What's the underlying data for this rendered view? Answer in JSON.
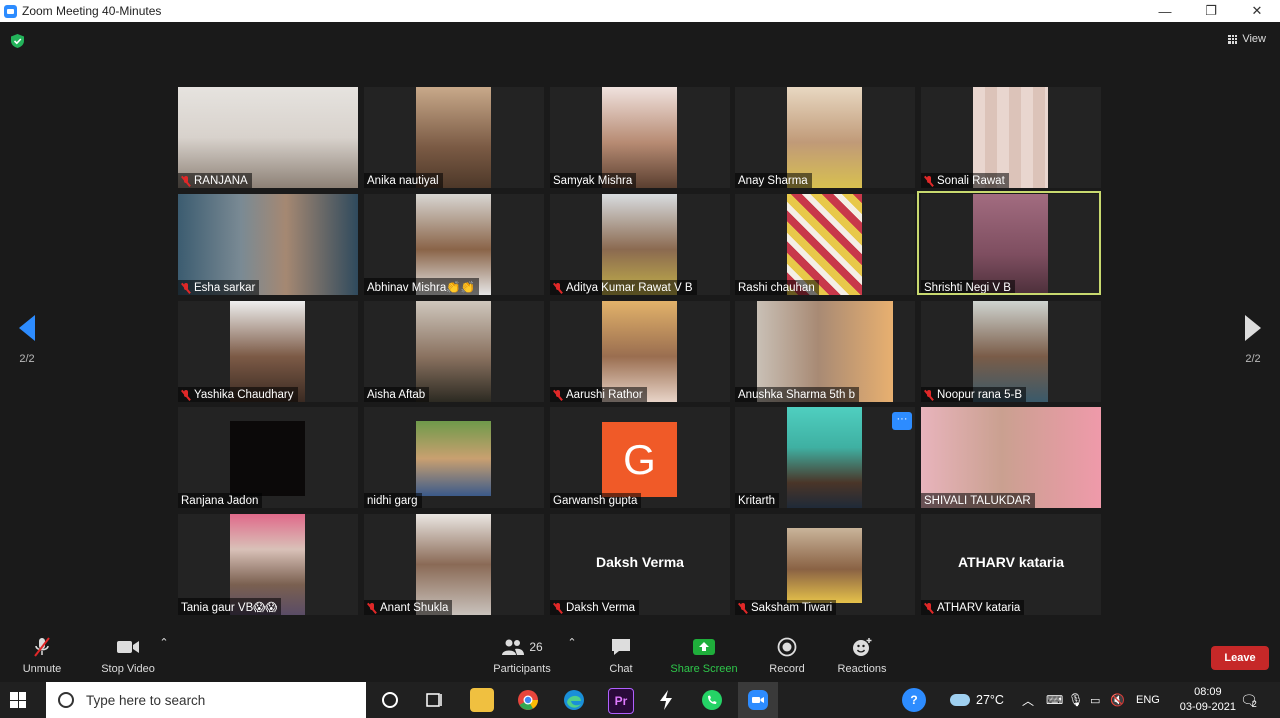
{
  "window": {
    "title": "Zoom Meeting 40-Minutes",
    "minimize": "—",
    "restore": "❐",
    "close": "✕"
  },
  "header": {
    "view_label": "View"
  },
  "pagination": {
    "left": "2/2",
    "right": "2/2"
  },
  "participants_tiles": [
    {
      "name": "RANJANA",
      "muted": true,
      "video": true
    },
    {
      "name": "Anika nautiyal",
      "muted": false,
      "video": true
    },
    {
      "name": "Samyak Mishra",
      "muted": false,
      "video": true
    },
    {
      "name": "Anay Sharma",
      "muted": false,
      "video": true
    },
    {
      "name": "Sonali Rawat",
      "muted": true,
      "video": true
    },
    {
      "name": "Esha sarkar",
      "muted": true,
      "video": true
    },
    {
      "name": "Abhinav Mishra👏👏",
      "muted": false,
      "video": true
    },
    {
      "name": "Aditya Kumar Rawat V B",
      "muted": true,
      "video": true
    },
    {
      "name": "Rashi chauhan",
      "muted": false,
      "video": true
    },
    {
      "name": "Shrishti Negi V B",
      "muted": false,
      "video": true,
      "active_speaker": true
    },
    {
      "name": "Yashika Chaudhary",
      "muted": true,
      "video": true
    },
    {
      "name": "Aisha Aftab",
      "muted": false,
      "video": true
    },
    {
      "name": "Aarushi Rathor",
      "muted": true,
      "video": true
    },
    {
      "name": "Anushka Sharma 5th b",
      "muted": false,
      "video": true
    },
    {
      "name": "Noopur rana 5-B",
      "muted": true,
      "video": true
    },
    {
      "name": "Ranjana Jadon",
      "muted": false,
      "video": true
    },
    {
      "name": "nidhi garg",
      "muted": false,
      "video": true
    },
    {
      "name": "Garwansh gupta",
      "muted": false,
      "video": false,
      "avatar_letter": "G"
    },
    {
      "name": "Kritarth",
      "muted": false,
      "video": true
    },
    {
      "name": "SHIVALI TALUKDAR",
      "muted": false,
      "video": true
    },
    {
      "name": "Tania gaur VB😱😱",
      "muted": false,
      "video": true
    },
    {
      "name": "Anant Shukla",
      "muted": true,
      "video": true
    },
    {
      "name": "Daksh Verma",
      "muted": true,
      "video": false,
      "display_name": "Daksh Verma"
    },
    {
      "name": "Saksham Tiwari",
      "muted": true,
      "video": true
    },
    {
      "name": "ATHARV kataria",
      "muted": true,
      "video": false,
      "display_name": "ATHARV kataria"
    }
  ],
  "more_button": "···",
  "toolbar": {
    "unmute": "Unmute",
    "stop_video": "Stop Video",
    "participants": "Participants",
    "participants_count": "26",
    "chat": "Chat",
    "share_screen": "Share Screen",
    "record": "Record",
    "reactions": "Reactions",
    "leave": "Leave"
  },
  "taskbar": {
    "search_placeholder": "Type here to search",
    "weather": "27°C",
    "language": "ENG",
    "time": "08:09",
    "date": "03-09-2021",
    "notification_count": "2"
  },
  "colors": {
    "zoom_blue": "#2d8cff",
    "leave_red": "#c62828",
    "share_green": "#1fae3b",
    "active_border": "#c8d96f"
  }
}
